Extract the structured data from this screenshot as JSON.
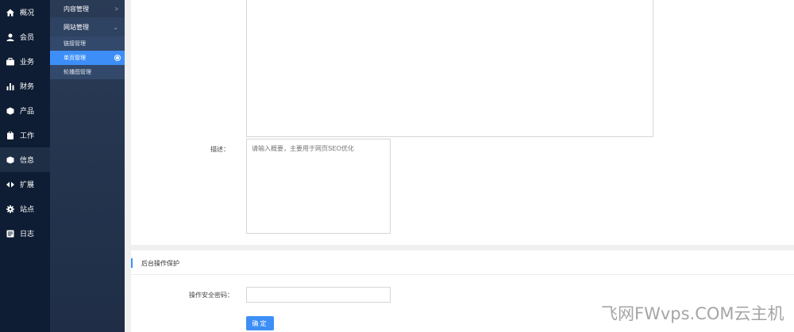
{
  "nav_primary": [
    {
      "label": "概况",
      "icon": "home-icon"
    },
    {
      "label": "会员",
      "icon": "user-icon"
    },
    {
      "label": "业务",
      "icon": "briefcase-icon"
    },
    {
      "label": "财务",
      "icon": "bar-chart-icon"
    },
    {
      "label": "产品",
      "icon": "cube-icon"
    },
    {
      "label": "工作",
      "icon": "clipboard-icon"
    },
    {
      "label": "信息",
      "icon": "box-icon",
      "active": true
    },
    {
      "label": "扩展",
      "icon": "expand-icon"
    },
    {
      "label": "站点",
      "icon": "gear-icon"
    },
    {
      "label": "日志",
      "icon": "log-icon"
    }
  ],
  "nav_secondary": {
    "group_content": {
      "label": "内容管理"
    },
    "group_site": {
      "label": "网站管理"
    },
    "subitems": [
      {
        "label": "链接管理"
      },
      {
        "label": "单页管理",
        "active": true
      },
      {
        "label": "轮播图管理"
      }
    ]
  },
  "form": {
    "desc_label": "描述：",
    "desc_placeholder": "请输入概要，主要用于网页SEO优化",
    "protect_title": "后台操作保护",
    "pwd_label": "操作安全密码：",
    "pwd_value": "",
    "submit_label": "确定"
  },
  "watermark": "飞网FWvps.COM云主机",
  "colors": {
    "accent": "#3d8ff7",
    "nav_bg": "#0e1d33",
    "subnav_bg": "#2a3b56"
  }
}
